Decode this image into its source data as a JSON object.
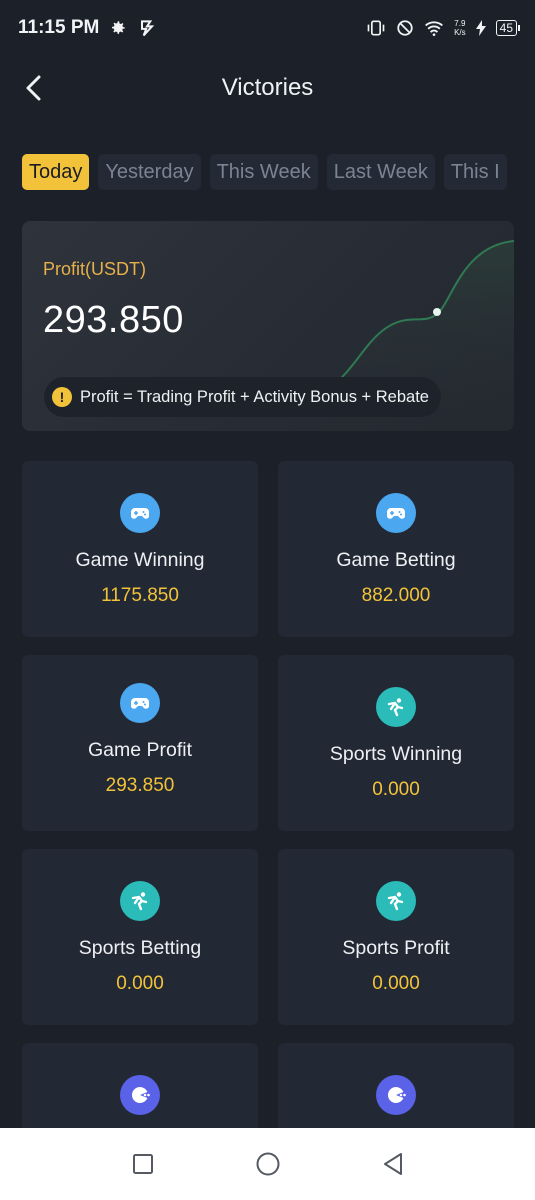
{
  "status_bar": {
    "time": "11:15 PM",
    "net_speed_value": "7.9",
    "net_speed_unit": "K/s",
    "battery": "45"
  },
  "header": {
    "title": "Victories",
    "back_icon": "chevron-left-icon"
  },
  "tabs": [
    {
      "label": "Today",
      "active": true
    },
    {
      "label": "Yesterday",
      "active": false
    },
    {
      "label": "This Week",
      "active": false
    },
    {
      "label": "Last Week",
      "active": false
    },
    {
      "label": "This I",
      "active": false
    }
  ],
  "profit_card": {
    "label": "Profit(USDT)",
    "value": "293.850",
    "formula": "Profit = Trading Profit + Activity Bonus + Rebate",
    "info_icon": "!"
  },
  "tiles": [
    {
      "label": "Game Winning",
      "value": "1175.850",
      "icon": "gamepad-icon"
    },
    {
      "label": "Game Betting",
      "value": "882.000",
      "icon": "gamepad-icon"
    },
    {
      "label": "Game Profit",
      "value": "293.850",
      "icon": "gamepad-icon"
    },
    {
      "label": "Sports Winning",
      "value": "0.000",
      "icon": "sports-icon"
    },
    {
      "label": "Sports Betting",
      "value": "0.000",
      "icon": "sports-icon"
    },
    {
      "label": "Sports Profit",
      "value": "0.000",
      "icon": "sports-icon"
    },
    {
      "label": "",
      "value": "",
      "icon": "pacman-icon"
    },
    {
      "label": "",
      "value": "",
      "icon": "pacman-icon"
    }
  ],
  "colors": {
    "accent": "#f2c33a",
    "background": "#1b2029",
    "card": "#232934",
    "gamepad": "#4ba8f0",
    "sports": "#2bbbb9",
    "pacman": "#5a62e8"
  },
  "nav": {
    "recent_icon": "square-icon",
    "home_icon": "circle-icon",
    "back_icon": "triangle-back-icon"
  }
}
